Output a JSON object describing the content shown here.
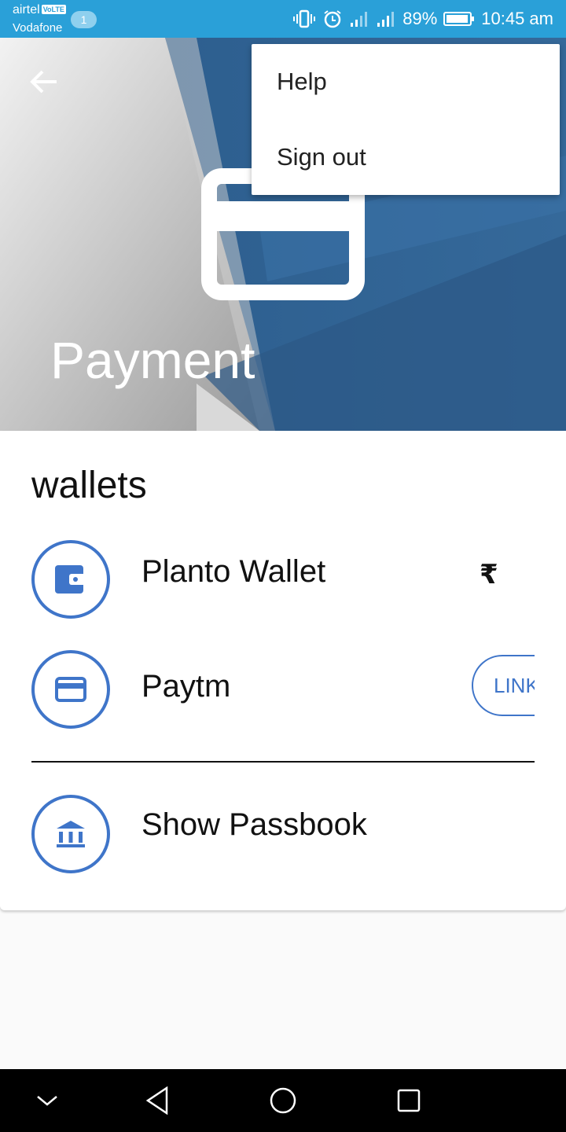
{
  "status_bar": {
    "carrier_1": "airtel",
    "volte_badge": "VoLTE",
    "carrier_2": "Vodafone",
    "notification_count": "1",
    "battery_percent": "89%",
    "time": "10:45 am"
  },
  "header": {
    "title": "Payment",
    "back_icon": "arrow-back-icon",
    "hero_icon": "credit-card-icon"
  },
  "menu": {
    "items": [
      "Help",
      "Sign out"
    ]
  },
  "wallets": {
    "section_title": "wallets",
    "items": [
      {
        "label": "Planto Wallet",
        "icon": "wallet-icon",
        "balance_symbol": "₹"
      },
      {
        "label": "Paytm",
        "icon": "credit-card-icon",
        "action_label": "LINK"
      }
    ],
    "passbook": {
      "label": "Show Passbook",
      "icon": "bank-icon"
    }
  },
  "nav_bar": {
    "icons": [
      "chevron-down-icon",
      "back-triangle-icon",
      "home-circle-icon",
      "recents-square-icon"
    ]
  },
  "colors": {
    "status_bar": "#2aa0d8",
    "accent": "#3f75c9",
    "header_blue": "#2f5f8e"
  }
}
